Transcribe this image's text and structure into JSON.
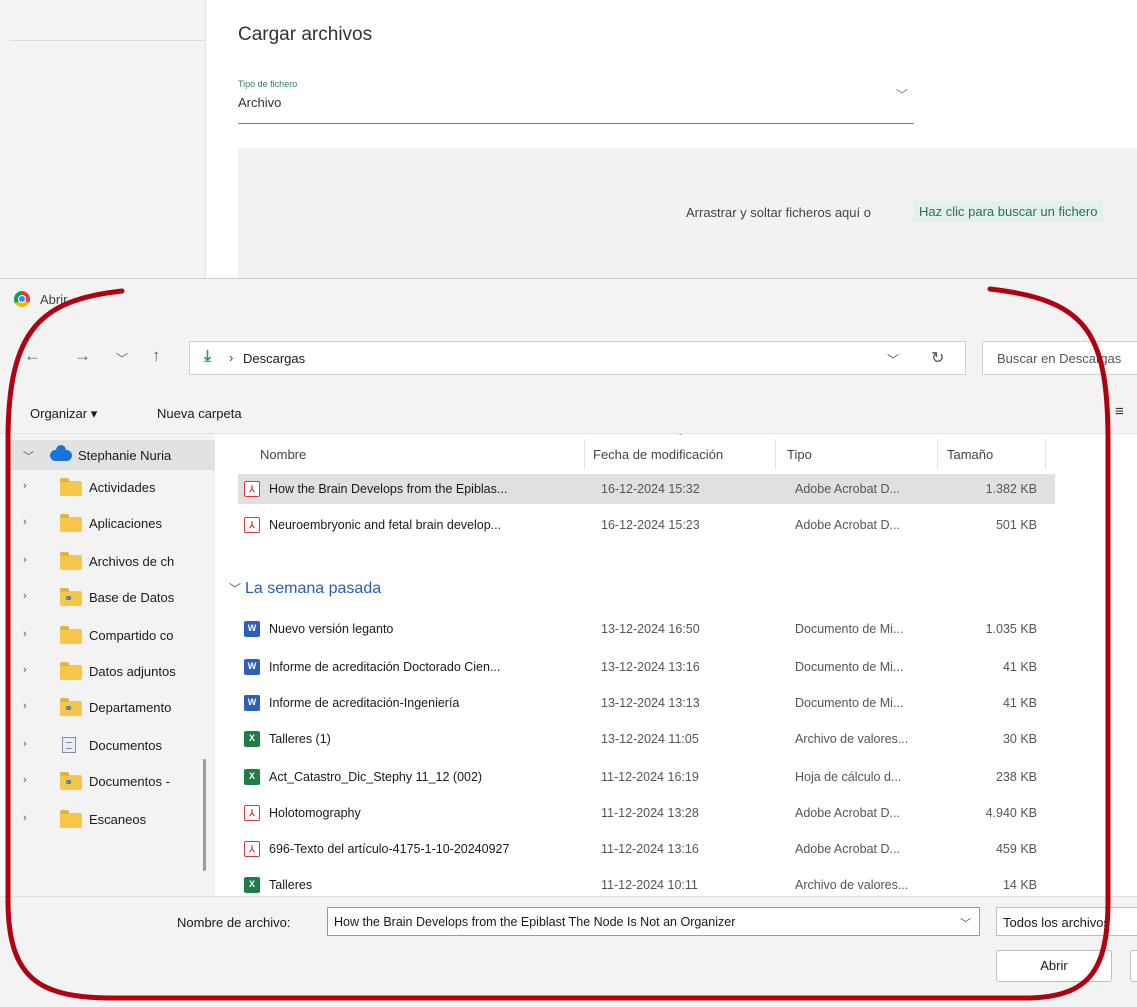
{
  "web": {
    "title": "Cargar archivos",
    "file_type_label": "Tipo de fichero",
    "file_type_value": "Archivo",
    "drop_text": "Arrastrar y soltar ficheros aquí o",
    "browse_link": "Haz clic para buscar un fichero"
  },
  "dialog": {
    "title": "Abrir",
    "address": {
      "current_folder": "Descargas"
    },
    "search_placeholder": "Buscar en Descargas",
    "toolbar": {
      "organize": "Organizar ▾",
      "new_folder": "Nueva carpeta"
    },
    "sidebar": {
      "root": "Stephanie Nuria",
      "items": [
        {
          "label": "Actividades",
          "icon": "folder-icon"
        },
        {
          "label": "Aplicaciones",
          "icon": "folder-icon"
        },
        {
          "label": "Archivos de ch",
          "icon": "folder-icon"
        },
        {
          "label": "Base de Datos",
          "icon": "shared-folder-icon"
        },
        {
          "label": "Compartido co",
          "icon": "folder-icon"
        },
        {
          "label": "Datos adjuntos",
          "icon": "folder-icon"
        },
        {
          "label": "Departamento",
          "icon": "shared-folder-icon"
        },
        {
          "label": "Documentos",
          "icon": "document-icon"
        },
        {
          "label": "Documentos -",
          "icon": "shared-folder-icon"
        },
        {
          "label": "Escaneos",
          "icon": "folder-icon"
        }
      ]
    },
    "columns": {
      "name": "Nombre",
      "date": "Fecha de modificación",
      "type": "Tipo",
      "size": "Tamaño"
    },
    "recent_files": [
      {
        "name": "How the Brain Develops from the Epiblas...",
        "date": "16-12-2024 15:32",
        "type": "Adobe Acrobat D...",
        "size": "1.382 KB",
        "icon": "pdf-icon",
        "selected": true
      },
      {
        "name": "Neuroembryonic and fetal brain develop...",
        "date": "16-12-2024 15:23",
        "type": "Adobe Acrobat D...",
        "size": "501 KB",
        "icon": "pdf-icon"
      }
    ],
    "group_last_week": "La semana pasada",
    "last_week_files": [
      {
        "name": "Nuevo versión leganto",
        "date": "13-12-2024 16:50",
        "type": "Documento de Mi...",
        "size": "1.035 KB",
        "icon": "word-icon"
      },
      {
        "name": "Informe de acreditación Doctorado Cien...",
        "date": "13-12-2024 13:16",
        "type": "Documento de Mi...",
        "size": "41 KB",
        "icon": "word-icon"
      },
      {
        "name": "Informe de acreditación-Ingeniería",
        "date": "13-12-2024 13:13",
        "type": "Documento de Mi...",
        "size": "41 KB",
        "icon": "word-icon"
      },
      {
        "name": "Talleres (1)",
        "date": "13-12-2024 11:05",
        "type": "Archivo de valores...",
        "size": "30 KB",
        "icon": "excel-icon"
      },
      {
        "name": "Act_Catastro_Dic_Stephy 11_12 (002)",
        "date": "11-12-2024 16:19",
        "type": "Hoja de cálculo d...",
        "size": "238 KB",
        "icon": "excel-icon"
      },
      {
        "name": "Holotomography",
        "date": "11-12-2024 13:28",
        "type": "Adobe Acrobat D...",
        "size": "4.940 KB",
        "icon": "pdf-icon"
      },
      {
        "name": "696-Texto del artículo-4175-1-10-20240927",
        "date": "11-12-2024 13:16",
        "type": "Adobe Acrobat D...",
        "size": "459 KB",
        "icon": "pdf-icon"
      },
      {
        "name": "Talleres",
        "date": "11-12-2024 10:11",
        "type": "Archivo de valores...",
        "size": "14 KB",
        "icon": "excel-icon"
      }
    ],
    "footer": {
      "filename_label": "Nombre de archivo:",
      "filename_value": "How the Brain Develops from the Epiblast The Node Is Not an Organizer",
      "filter": "Todos los archivos",
      "open_button": "Abrir"
    }
  },
  "colors": {
    "annotation": "#b00012",
    "accent": "#2a5dbf",
    "browse_link": "#2a6e63"
  }
}
